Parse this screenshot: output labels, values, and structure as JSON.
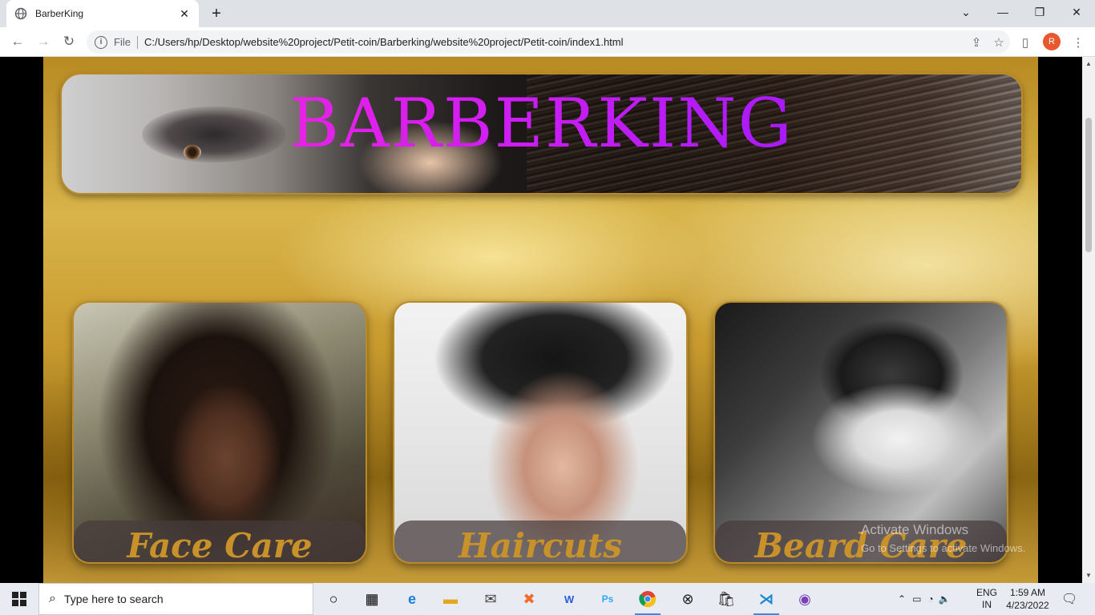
{
  "browser": {
    "tab_title": "BarberKing",
    "address_file_label": "File",
    "url": "C:/Users/hp/Desktop/website%20project/Petit-coin/Barberking/website%20project/Petit-coin/index1.html",
    "profile_initial": "R"
  },
  "page": {
    "banner_title": "BARBERKING",
    "cards": [
      {
        "label": "Face Care"
      },
      {
        "label": "Haircuts"
      },
      {
        "label": "Beard Care"
      }
    ],
    "watermark_title": "Activate Windows",
    "watermark_sub": "Go to Settings to activate Windows."
  },
  "taskbar": {
    "search_placeholder": "Type here to search",
    "language": "ENG",
    "region": "IN",
    "time": "1:59 AM",
    "date": "4/23/2022"
  },
  "colors": {
    "title_gradient_start": "#ff2ad4",
    "title_gradient_end": "#8b18ff",
    "card_label": "#c9912a",
    "card_border": "#b98a2a"
  },
  "icons": [
    "globe-icon",
    "close-icon",
    "plus-icon",
    "back-icon",
    "forward-icon",
    "reload-icon",
    "info-icon",
    "share-icon",
    "star-icon",
    "sidepanel-icon",
    "windows-icon",
    "search-icon",
    "cortana-icon",
    "taskview-icon",
    "edge-icon",
    "explorer-icon",
    "mail-icon",
    "xampp-icon",
    "wps-icon",
    "photoshop-icon",
    "chrome-icon",
    "xbox-icon",
    "store-icon",
    "vscode-icon",
    "github-icon",
    "notification-icon"
  ]
}
